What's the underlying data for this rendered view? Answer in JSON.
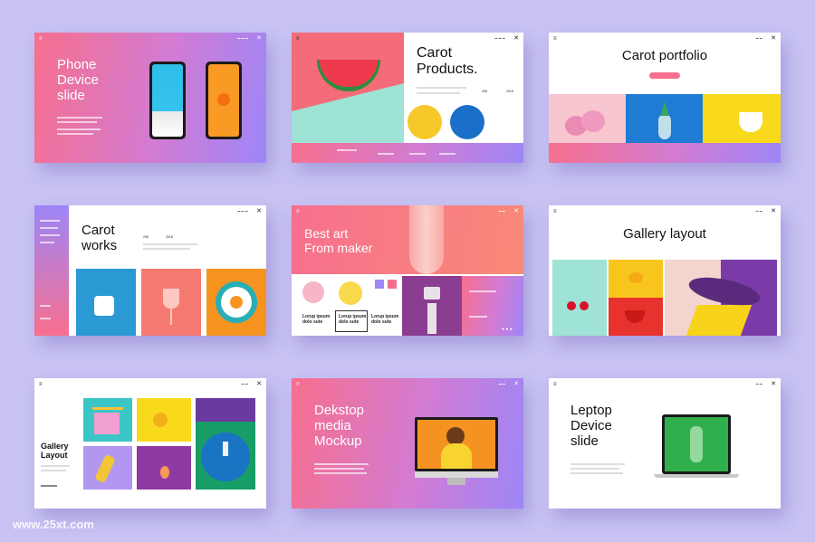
{
  "colors": {
    "background": "#c8c3f3",
    "pink": "#f76f8e",
    "purple": "#9d86f7",
    "accent": "#f76f8e"
  },
  "watermark": "www.25xt.com",
  "slides": [
    {
      "title": "Phone\nDevice\nslide"
    },
    {
      "title": "Carot\nProducts.",
      "year_from": "208",
      "year_to": "2018"
    },
    {
      "title": "Carot portfolio"
    },
    {
      "title": "Carot\nworks",
      "year_from": "208",
      "year_to": "2018"
    },
    {
      "title": "Best art\nFrom maker",
      "card1": "Lorup ipsum\ndolo sute",
      "card2": "Lorup ipsum\ndolo sute",
      "card3": "Lorup ipsum\ndolo sute"
    },
    {
      "title": "Gallery layout"
    },
    {
      "title": "Gallery\nLayout"
    },
    {
      "title": "Dekstop\nmedia\nMockup"
    },
    {
      "title": "Leptop\nDevice\nslide"
    }
  ],
  "icons": [
    "menu-icon",
    "close-icon"
  ]
}
